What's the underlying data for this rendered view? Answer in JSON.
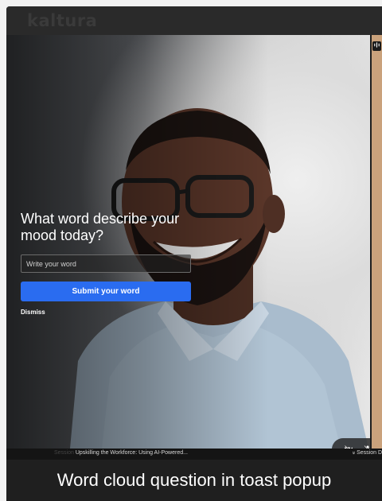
{
  "app": {
    "logo_text": "kaltura"
  },
  "stage": {
    "participant_badge_icon": "audio-wave-icon"
  },
  "toast": {
    "question": "What word describe your mood today?",
    "input_placeholder": "Write your word",
    "input_value": "",
    "submit_label": "Submit your word",
    "dismiss_label": "Dismiss"
  },
  "controls": {
    "camera_icon": "camera-off-icon",
    "mic_icon": "mic-off-icon"
  },
  "footer": {
    "session_prefix": "Session",
    "session_title": "Upskilling the Workforce: Using AI-Powered...",
    "session_details": "Session D"
  },
  "caption": {
    "text": "Word cloud question in toast popup"
  },
  "colors": {
    "accent": "#2a6cf0",
    "frame": "#1f1f1f"
  }
}
